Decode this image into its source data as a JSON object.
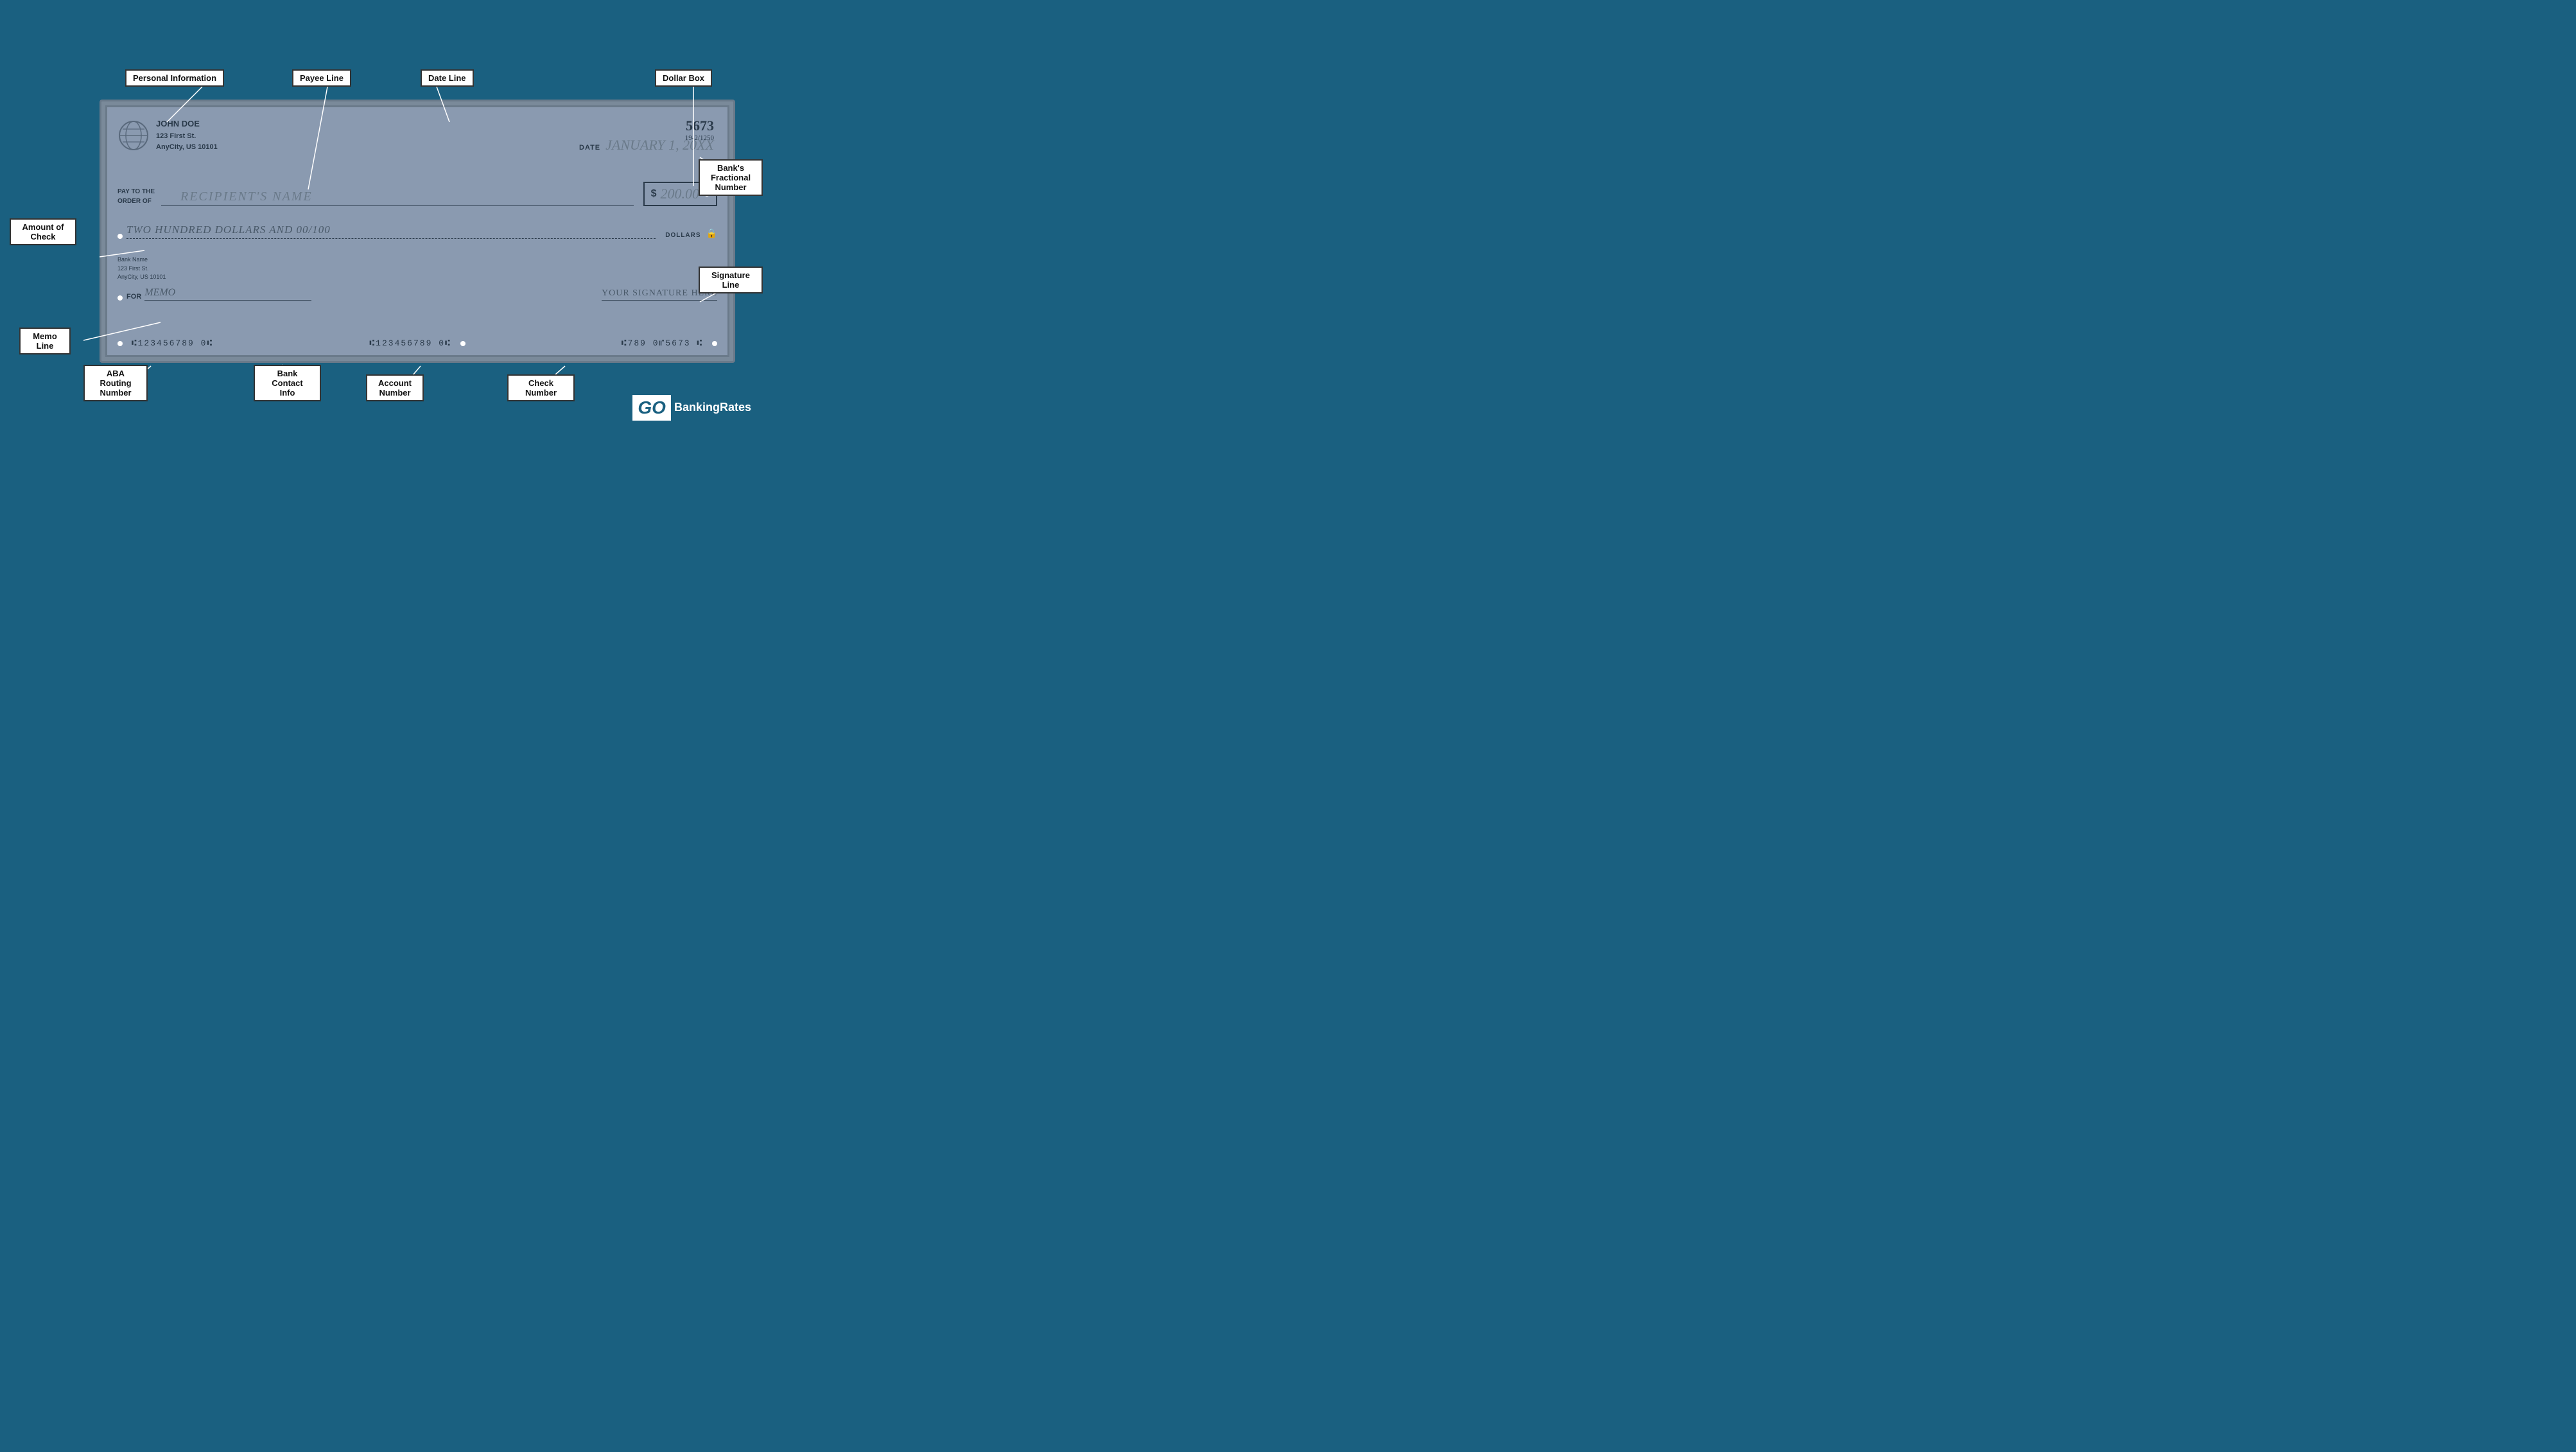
{
  "labels": {
    "personal_information": "Personal Information",
    "payee_line": "Payee Line",
    "date_line": "Date Line",
    "dollar_box": "Dollar Box",
    "amount_of_check": "Amount of Check",
    "banks_fractional_number": "Bank's\nFractional\nNumber",
    "signature_line": "Signature Line",
    "memo_line": "Memo Line",
    "aba_routing_number": "ABA Routing\nNumber",
    "bank_contact_info": "Bank Contact\nInfo",
    "account_number": "Account\nNumber",
    "check_number": "Check Number"
  },
  "check": {
    "check_number": "5673",
    "fractional": "19-2/1250",
    "owner_name": "JOHN DOE",
    "owner_address1": "123 First St.",
    "owner_address2": "AnyCity, US 10101",
    "date_label": "DATE",
    "date_value": "JANUARY 1, 20XX",
    "pay_label": "PAY TO THE\nORDER OF",
    "payee_name": "RECIPIENT'S NAME",
    "dollar_sign": "$",
    "amount_numeric": "200.00",
    "amount_written": "TWO HUNDRED DOLLARS AND 00/100",
    "dollars_label": "DOLLARS",
    "bank_name": "Bank Name",
    "bank_address1": "123 First St.",
    "bank_address2": "AnyCity, US 10101",
    "memo_label": "FOR",
    "memo_value": "MEMO",
    "signature_text": "YOUR SIGNATURE HERE",
    "micr_routing": "⑆123456789 0⑆",
    "micr_bank_contact": "⑆123456789 0⑆",
    "micr_account": "⑆789 0⑈5673 ⑆"
  },
  "logo": {
    "go": "GO",
    "banking_rates": "BankingRates"
  }
}
